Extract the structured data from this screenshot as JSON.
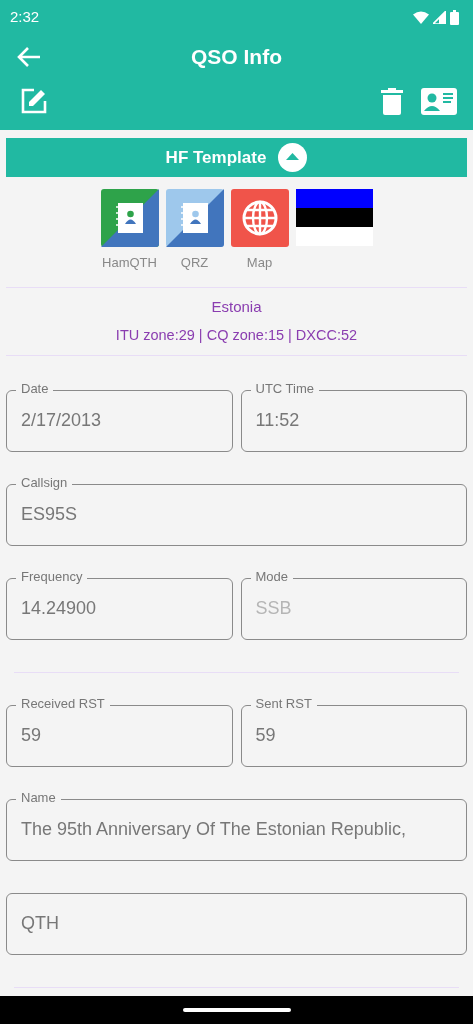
{
  "status_bar": {
    "time": "2:32"
  },
  "toolbar": {
    "title": "QSO Info"
  },
  "template": {
    "label": "HF Template",
    "expanded": true
  },
  "lookups": [
    {
      "kind": "hamqth",
      "label": "HamQTH"
    },
    {
      "kind": "qrz",
      "label": "QRZ"
    },
    {
      "kind": "map",
      "label": "Map"
    },
    {
      "kind": "flag"
    }
  ],
  "country": {
    "name": "Estonia",
    "zones": "ITU zone:29 | CQ zone:15 | DXCC:52"
  },
  "form": [
    {
      "kind": "fields",
      "fields": [
        {
          "label": "Date",
          "value": "2/17/2013",
          "disabled": false
        },
        {
          "label": "UTC Time",
          "value": "11:52",
          "disabled": false
        }
      ]
    },
    {
      "kind": "fields",
      "fields": [
        {
          "label": "Callsign",
          "value": "ES95S",
          "disabled": false
        }
      ]
    },
    {
      "kind": "fields",
      "fields": [
        {
          "label": "Frequency",
          "value": "14.24900",
          "disabled": false
        },
        {
          "label": "Mode",
          "value": "SSB",
          "disabled": true
        }
      ]
    },
    {
      "kind": "divider"
    },
    {
      "kind": "fields",
      "fields": [
        {
          "label": "Received RST",
          "value": "59",
          "disabled": false
        },
        {
          "label": "Sent RST",
          "value": "59",
          "disabled": false
        }
      ]
    },
    {
      "kind": "fields",
      "fields": [
        {
          "label": "Name",
          "value": "The 95th Anniversary Of The Estonian Republic,",
          "disabled": false
        }
      ]
    },
    {
      "kind": "fields",
      "fields": [
        {
          "placeholder": "QTH"
        }
      ]
    },
    {
      "kind": "divider"
    }
  ]
}
